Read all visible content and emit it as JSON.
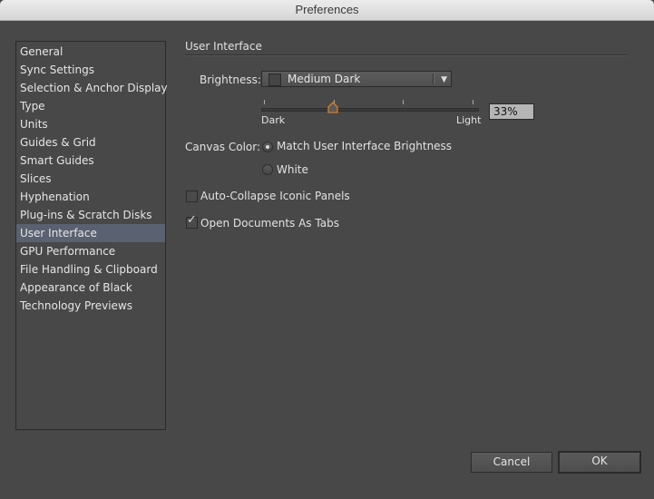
{
  "window": {
    "title": "Preferences"
  },
  "sidebar": {
    "selected": "User Interface",
    "items": [
      {
        "label": "General"
      },
      {
        "label": "Sync Settings"
      },
      {
        "label": "Selection & Anchor Display"
      },
      {
        "label": "Type"
      },
      {
        "label": "Units"
      },
      {
        "label": "Guides & Grid"
      },
      {
        "label": "Smart Guides"
      },
      {
        "label": "Slices"
      },
      {
        "label": "Hyphenation"
      },
      {
        "label": "Plug-ins & Scratch Disks"
      },
      {
        "label": "User Interface"
      },
      {
        "label": "GPU Performance"
      },
      {
        "label": "File Handling & Clipboard"
      },
      {
        "label": "Appearance of Black"
      },
      {
        "label": "Technology Previews"
      }
    ]
  },
  "panel": {
    "section_title": "User Interface",
    "brightness": {
      "label": "Brightness:",
      "selected": "Medium Dark",
      "slider_min_label": "Dark",
      "slider_max_label": "Light",
      "value_percent": 33,
      "value_text": "33%"
    },
    "canvas_color": {
      "label": "Canvas Color:",
      "options": [
        {
          "label": "Match User Interface Brightness",
          "checked": true
        },
        {
          "label": "White",
          "checked": false
        }
      ]
    },
    "checkboxes": [
      {
        "label": "Auto-Collapse Iconic Panels",
        "checked": false
      },
      {
        "label": "Open Documents As Tabs",
        "checked": true
      }
    ]
  },
  "buttons": {
    "cancel": "Cancel",
    "ok": "OK"
  },
  "colors": {
    "selection": "#5a6170",
    "slider_thumb": "#e07b1f",
    "background": "#484848"
  }
}
